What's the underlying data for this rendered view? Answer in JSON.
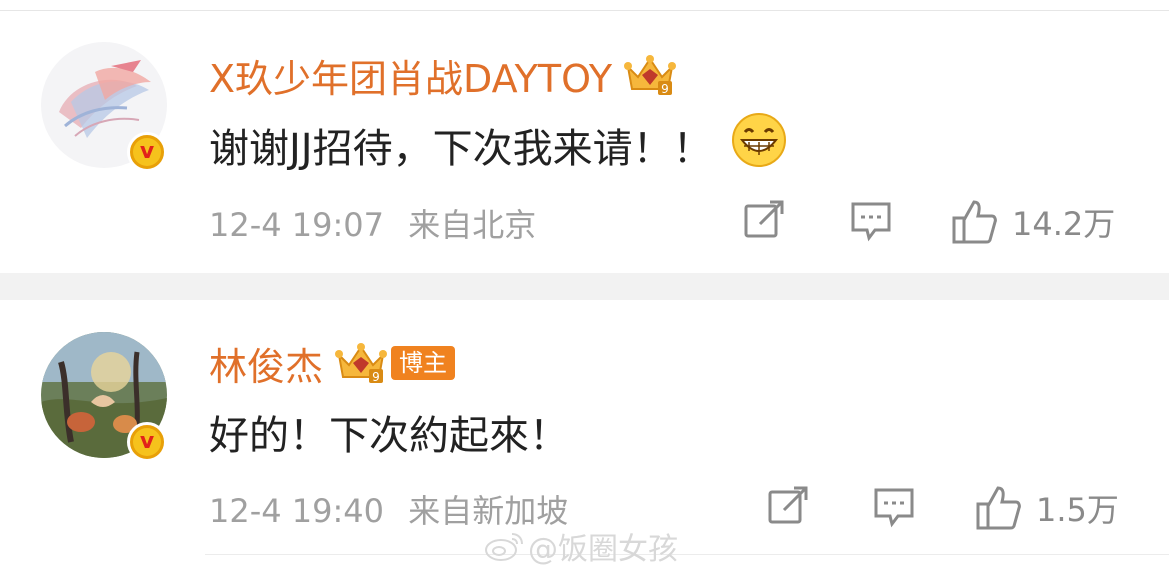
{
  "comments": [
    {
      "username": "X玖少年团肖战DAYTOY",
      "text": "谢谢JJ招待，下次我来请！！",
      "emoji": "grinning-face",
      "time": "12-4 19:07",
      "location": "来自北京",
      "likes": "14.2万",
      "verified_label": "v"
    },
    {
      "username": "林俊杰",
      "badge": "博主",
      "text": "好的！下次約起來！",
      "time": "12-4 19:40",
      "location": "来自新加坡",
      "likes": "1.5万",
      "verified_label": "v"
    }
  ],
  "watermark": "@饭圈女孩",
  "colors": {
    "username": "#e0702a",
    "badge_bg": "#f0821f",
    "meta": "#a0a0a0",
    "separator": "#f2f2f2",
    "verified": "#f6c21c"
  }
}
